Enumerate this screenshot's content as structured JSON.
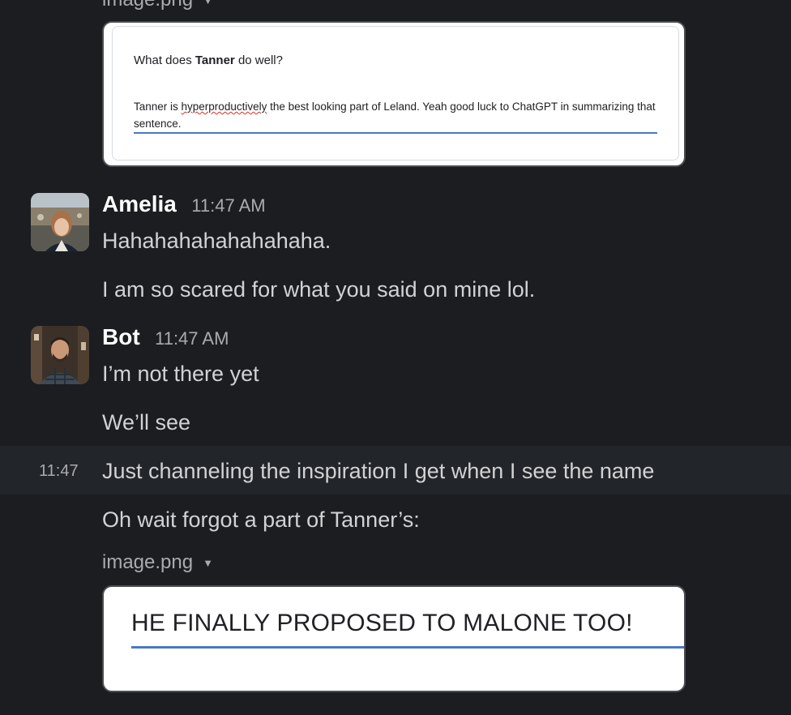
{
  "top_attachment": {
    "filename": "image.png",
    "question_prefix": "What does ",
    "question_bold": "Tanner",
    "question_suffix": " do well?",
    "answer_part1": "Tanner is ",
    "answer_misspelled": "hyperproductively",
    "answer_part2": " the best looking part of Leland. Yeah good luck to ChatGPT in summarizing that sentence."
  },
  "messages": [
    {
      "author": "Amelia",
      "time": "11:47 AM",
      "lines": [
        "Hahahahahahahahaha.",
        "I am so scared for what you said on mine lol."
      ]
    },
    {
      "author": "Bot",
      "time": "11:47 AM",
      "lines": [
        "I’m not there yet",
        "We’ll see"
      ]
    }
  ],
  "continued": {
    "hover_time": "11:47",
    "line1": "Just channeling the inspiration I get when I see the name",
    "line2": "Oh wait forgot a part of Tanner’s:",
    "attachment": {
      "filename": "image.png",
      "caret_icon": "caret-down-icon",
      "text": "HE FINALLY PROPOSED TO MALONE TOO!"
    }
  },
  "colors": {
    "background": "#1b1d21",
    "hover_background": "#222529",
    "text": "#d1d2d3",
    "muted": "#ababad",
    "link_underline": "#4a79c4"
  }
}
